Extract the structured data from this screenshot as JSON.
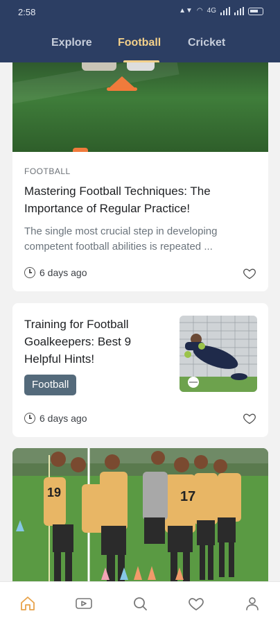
{
  "status_bar": {
    "time": "2:58",
    "network_text": "4G",
    "battery": ""
  },
  "tabs": [
    {
      "label": "Explore",
      "active": false
    },
    {
      "label": "Football",
      "active": true
    },
    {
      "label": "Cricket",
      "active": false
    }
  ],
  "colors": {
    "header_bg": "#2c3e63",
    "accent": "#f3d08a",
    "tag_bg": "#546a7b",
    "home_active": "#e8a24a"
  },
  "articles": [
    {
      "category": "FOOTBALL",
      "title": "Mastering Football Techniques: The Importance of Regular Practice!",
      "excerpt": "The single most crucial step in developing competent football abilities is repeated ...",
      "time_ago": "6 days ago",
      "image": "football-cones-on-grass"
    },
    {
      "title": "Training for Football Goalkeepers: Best 9 Helpful Hints!",
      "tag": "Football",
      "time_ago": "6 days ago",
      "image": "goalkeeper-diving-save"
    },
    {
      "image": "youth-football-team-huddle"
    }
  ],
  "bottom_nav": [
    {
      "icon": "home-icon",
      "active": true
    },
    {
      "icon": "video-icon",
      "active": false
    },
    {
      "icon": "search-icon",
      "active": false
    },
    {
      "icon": "heart-icon",
      "active": false
    },
    {
      "icon": "profile-icon",
      "active": false
    }
  ]
}
